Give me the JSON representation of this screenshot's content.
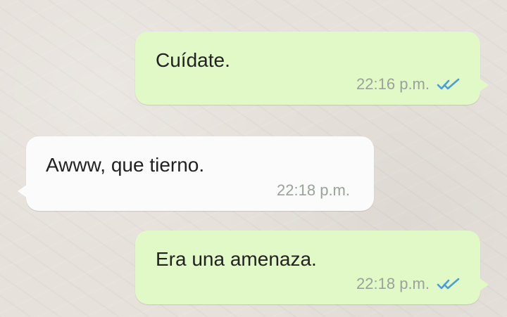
{
  "theme": {
    "wallpaper_color": "#e6e1db",
    "outgoing_bubble_color": "#e1f8c7",
    "incoming_bubble_color": "#fbfbfb",
    "text_color": "#222222",
    "time_color": "#9aa39a",
    "read_check_color": "#4a9fd8"
  },
  "messages": [
    {
      "direction": "outgoing",
      "text": "Cuídate.",
      "time": "22:16 p.m.",
      "status_icon": "double-check-read-icon"
    },
    {
      "direction": "incoming",
      "text": "Awww, que tierno.",
      "time": "22:18 p.m."
    },
    {
      "direction": "outgoing",
      "text": "Era una amenaza.",
      "time": "22:18 p.m.",
      "status_icon": "double-check-read-icon"
    }
  ]
}
